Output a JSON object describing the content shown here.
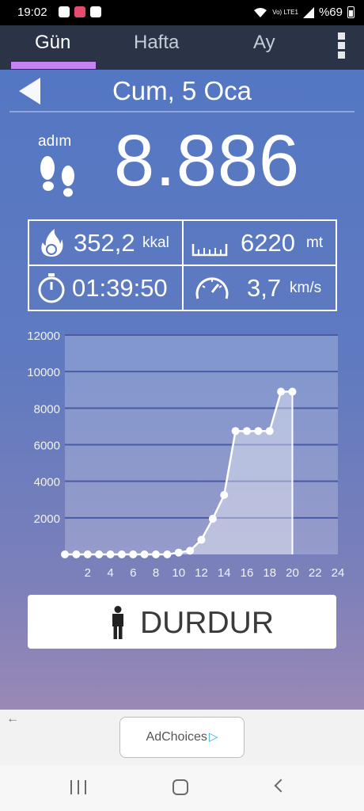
{
  "status_bar": {
    "time": "19:02",
    "lte": "Vo) LTE1",
    "battery": "%69"
  },
  "tabs": [
    {
      "label": "Gün",
      "active": true
    },
    {
      "label": "Hafta",
      "active": false
    },
    {
      "label": "Ay",
      "active": false
    }
  ],
  "header": {
    "date": "Cum, 5 Oca"
  },
  "steps": {
    "label": "adım",
    "value": "8.886"
  },
  "stats": {
    "calories": {
      "value": "352,2",
      "unit": "kkal",
      "icon": "flame-icon"
    },
    "distance": {
      "value": "6220",
      "unit": "mt",
      "icon": "ruler-icon"
    },
    "duration": {
      "value": "01:39:50",
      "icon": "stopwatch-icon"
    },
    "speed": {
      "value": "3,7",
      "unit": "km/s",
      "icon": "speedometer-icon"
    }
  },
  "chart_data": {
    "type": "area",
    "x": [
      0,
      1,
      2,
      3,
      4,
      5,
      6,
      7,
      8,
      9,
      10,
      11,
      12,
      13,
      14,
      15,
      16,
      17,
      18,
      19,
      20
    ],
    "values": [
      0,
      0,
      0,
      0,
      0,
      0,
      0,
      0,
      0,
      0,
      100,
      200,
      800,
      1950,
      3250,
      6750,
      6750,
      6750,
      6750,
      8900,
      8900
    ],
    "ylim": [
      0,
      12000
    ],
    "xlim": [
      0,
      24
    ],
    "y_ticks": [
      "12000",
      "10000",
      "8000",
      "6000",
      "4000",
      "2000"
    ],
    "x_ticks": [
      "2",
      "4",
      "6",
      "8",
      "10",
      "12",
      "14",
      "16",
      "18",
      "20",
      "22",
      "24"
    ],
    "grid": true
  },
  "stop_button": {
    "label": "DURDUR"
  },
  "ad": {
    "label": "AdChoices",
    "back_arrow": "←"
  },
  "colors": {
    "accent_tab": "#c485f2",
    "background_top": "#5477c3",
    "background_bottom": "#9a88b5"
  }
}
